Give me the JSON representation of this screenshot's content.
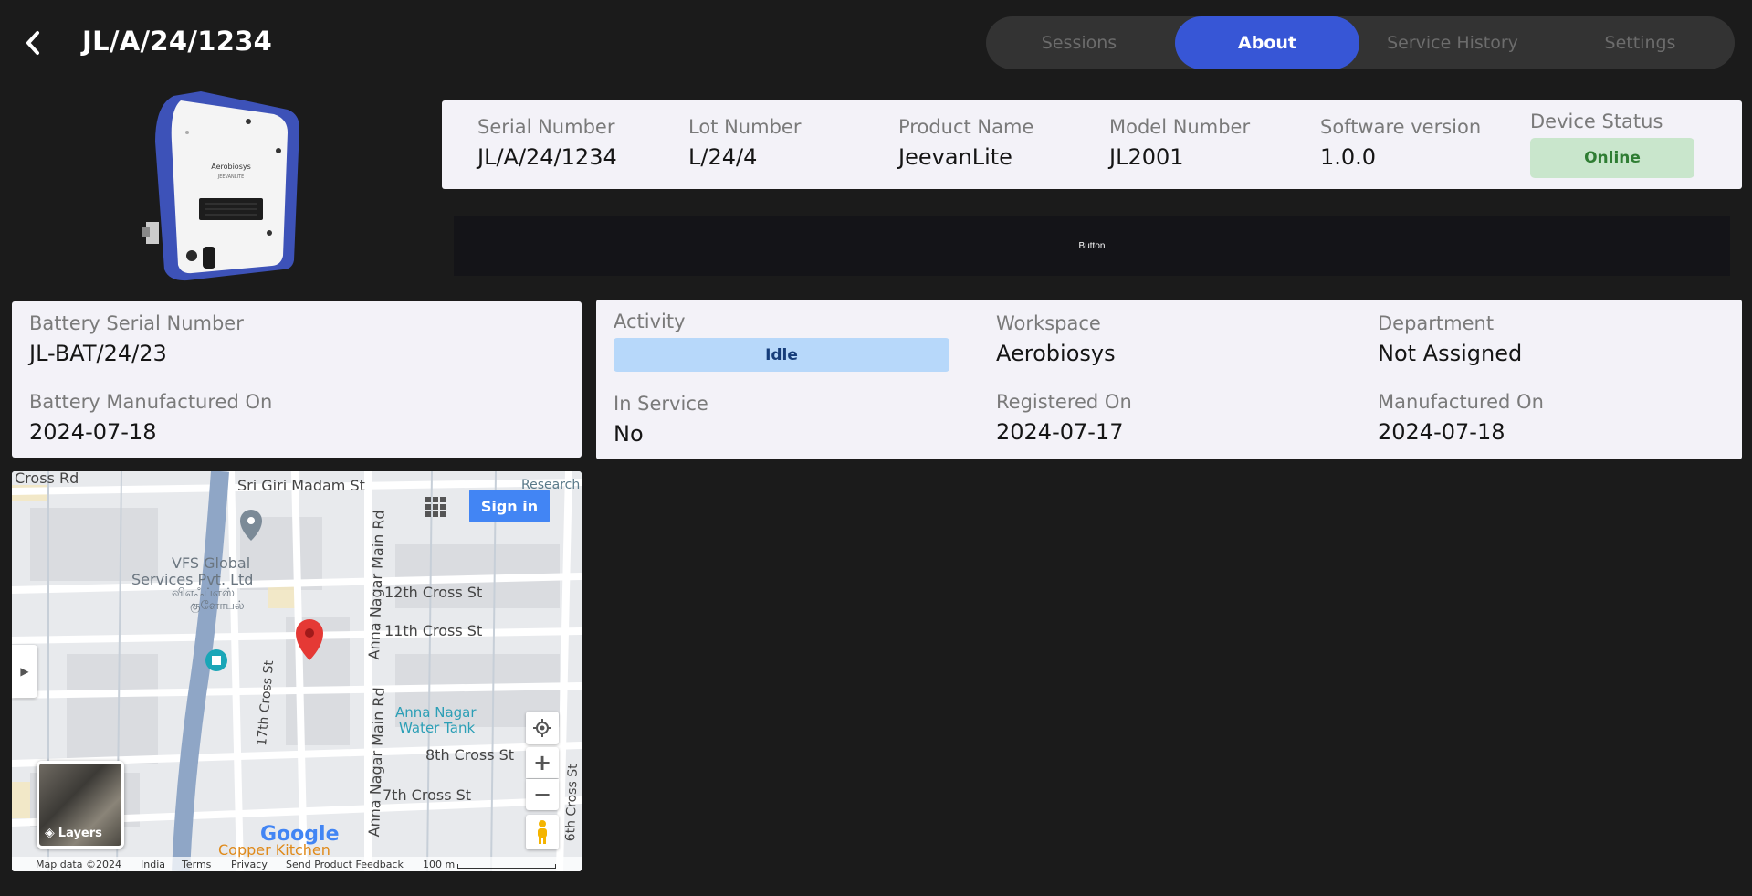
{
  "header": {
    "title": "JL/A/24/1234",
    "tabs": [
      "Sessions",
      "About",
      "Service History",
      "Settings"
    ],
    "active_tab": "About"
  },
  "device_image": {
    "brand": "Aerobiosys",
    "sub": "JEEVANLITE"
  },
  "info": {
    "serial_label": "Serial Number",
    "serial_value": "JL/A/24/1234",
    "lot_label": "Lot Number",
    "lot_value": "L/24/4",
    "product_label": "Product Name",
    "product_value": "JeevanLite",
    "model_label": "Model Number",
    "model_value": "JL2001",
    "software_label": "Software version",
    "software_value": "1.0.0",
    "status_label": "Device Status",
    "status_value": "Online"
  },
  "button": {
    "label": "Button"
  },
  "battery": {
    "serial_label": "Battery Serial Number",
    "serial_value": "JL-BAT/24/23",
    "mfg_label": "Battery Manufactured On",
    "mfg_value": "2024-07-18"
  },
  "details": {
    "activity_label": "Activity",
    "activity_value": "Idle",
    "workspace_label": "Workspace",
    "workspace_value": "Aerobiosys",
    "department_label": "Department",
    "department_value": "Not Assigned",
    "in_service_label": "In Service",
    "in_service_value": "No",
    "registered_label": "Registered On",
    "registered_value": "2024-07-17",
    "manufactured_label": "Manufactured On",
    "manufactured_value": "2024-07-18"
  },
  "map": {
    "sign_in": "Sign in",
    "layers": "Layers",
    "labels": {
      "cross_rd": "Cross Rd",
      "sri_giri": "Sri Giri Madam St",
      "research": "Research",
      "vfs1": "VFS Global",
      "vfs2": "Services Pvt. Ltd",
      "vfs_tamil1": "விஎஃப்எஸ்",
      "vfs_tamil2": "குளோபல்",
      "cross12": "12th Cross St",
      "cross11": "11th Cross St",
      "cross8": "8th Cross St",
      "cross7": "7th Cross St",
      "cross17": "17th Cross St",
      "cross6": "6th Cross St",
      "anna_main": "Anna Nagar Main Rd",
      "tank1": "Anna Nagar",
      "tank2": "Water Tank",
      "copper": "Copper Kitchen",
      "google": "Google"
    },
    "footer": {
      "data": "Map data ©2024",
      "country": "India",
      "terms": "Terms",
      "privacy": "Privacy",
      "feedback": "Send Product Feedback",
      "scale": "100 m"
    }
  },
  "colors": {
    "background": "#1b1b1b",
    "accent": "#3756d6",
    "online_bg": "#c9e6cc",
    "online_text": "#2f7d33",
    "idle_bg": "#b7d8fa",
    "card_bg": "#f3f2f8"
  }
}
